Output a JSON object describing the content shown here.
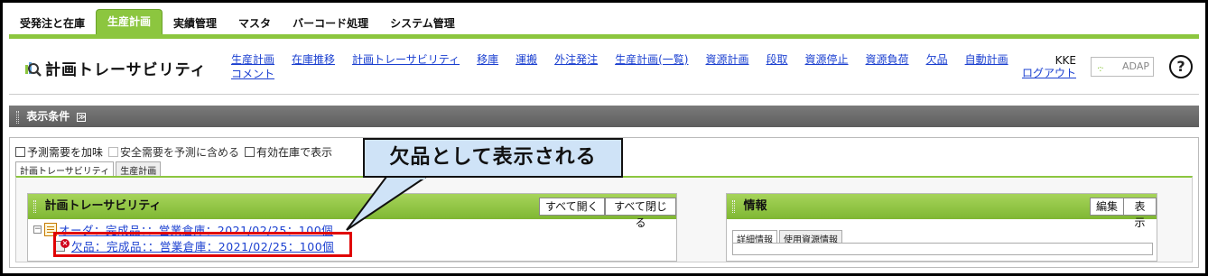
{
  "topnav": {
    "tabs": [
      "受発注と在庫",
      "生産計画",
      "実績管理",
      "マスタ",
      "バーコード処理",
      "システム管理"
    ],
    "active_index": 1
  },
  "header": {
    "title": "計画トレーサビリティ",
    "links": [
      "生産計画コメント",
      "在庫推移",
      "計画トレーサビリティ",
      "移庫",
      "運搬",
      "外注発注",
      "生産計画(一覧)",
      "資源計画",
      "段取",
      "資源停止",
      "資源負荷",
      "欠品",
      "自動計画"
    ],
    "link_lines": {
      "line1": "生産計画",
      "line2": "コメント"
    },
    "user_name": "KKE",
    "logout_label": "ログアウト",
    "logo_text": "ADAP",
    "help_label": "?"
  },
  "conditions": {
    "title": "表示条件",
    "toggle": "≫",
    "options": [
      {
        "label": "予測需要を加味",
        "checked": false,
        "disabled": false
      },
      {
        "label": "安全需要を予測に含める",
        "checked": false,
        "disabled": true
      },
      {
        "label": "有効在庫で表示",
        "checked": false,
        "disabled": false
      }
    ],
    "tabs": [
      "計画トレーサビリティ",
      "生産計画"
    ]
  },
  "trace_panel": {
    "title": "計画トレーサビリティ",
    "expand_all": "すべて開く",
    "collapse_all": "すべて閉じる",
    "rows": [
      {
        "text": "オーダ：完成品：：営業倉庫：2021/02/25：100個"
      },
      {
        "text": "欠品：完成品：：営業倉庫：2021/02/25：100個"
      }
    ]
  },
  "info_panel": {
    "title": "情報",
    "edit_label": "編集",
    "show_label": "表示",
    "tabs": [
      "詳細情報",
      "使用資源情報"
    ]
  },
  "callout": {
    "text": "欠品として表示される",
    "highlight_color": "#e00000"
  },
  "colors": {
    "accent": "#8cc63f",
    "link": "#1a3fd0",
    "header_bar": "#6a6a6a"
  }
}
